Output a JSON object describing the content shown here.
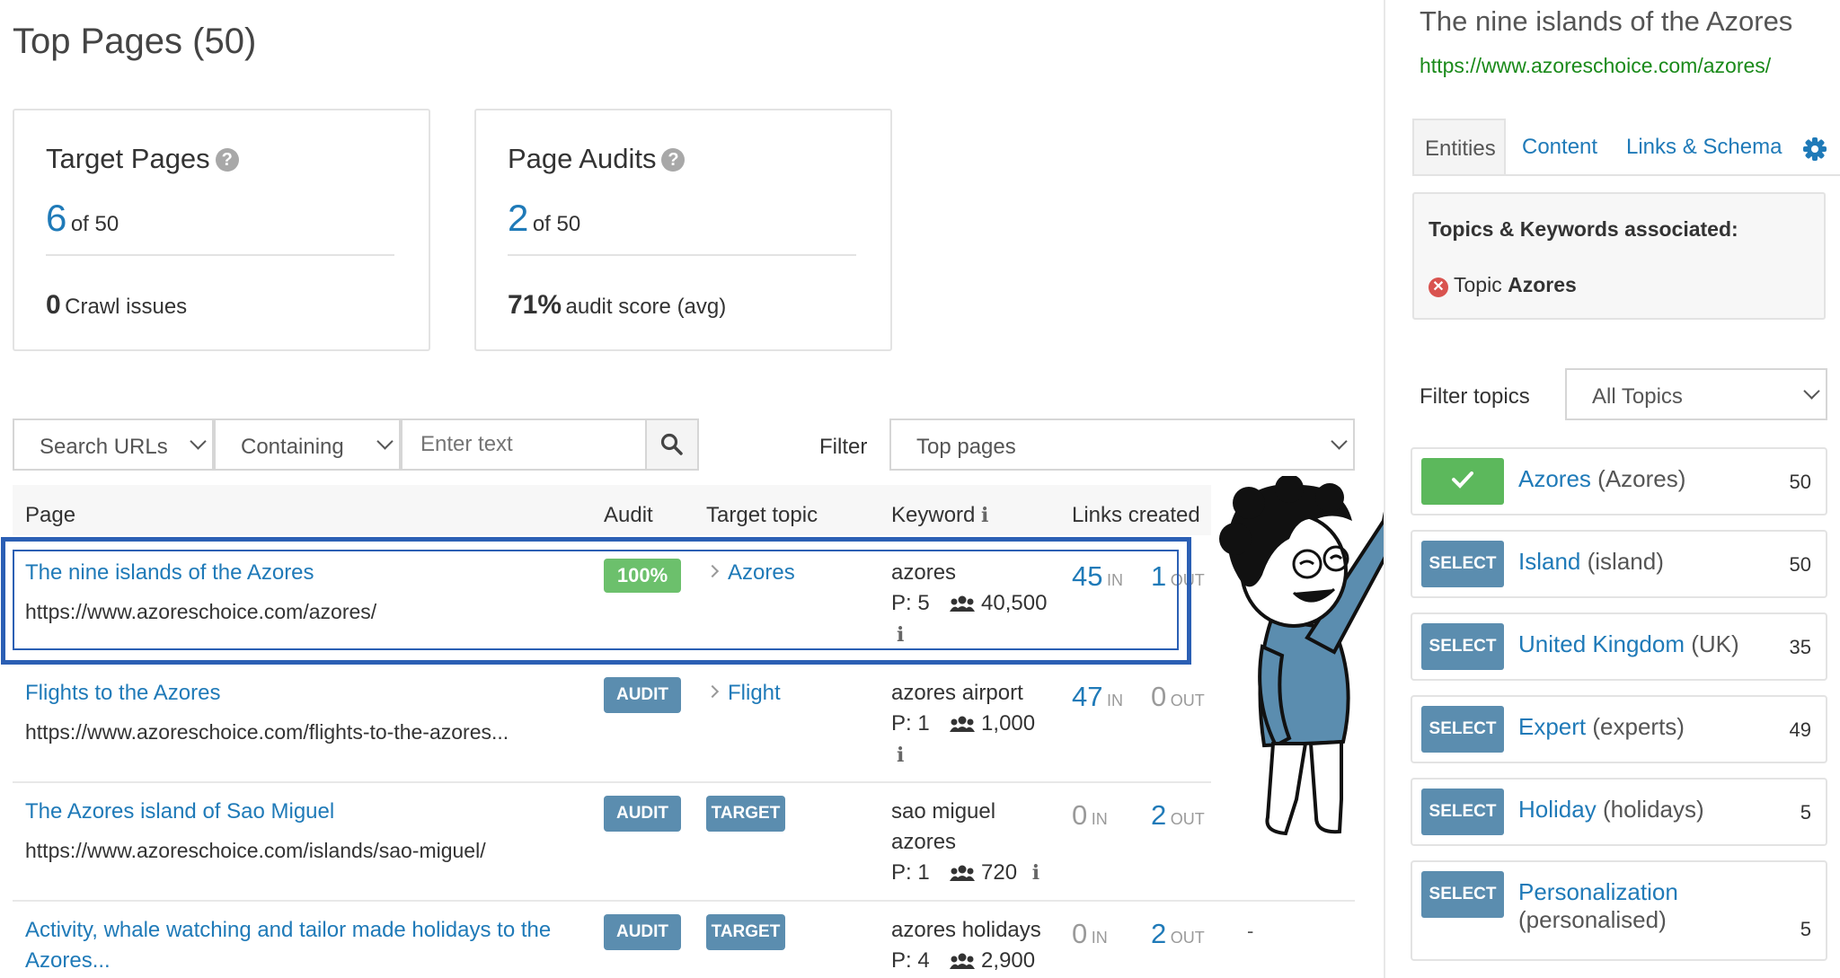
{
  "page": {
    "title": "Top Pages (50)"
  },
  "cards": {
    "target_pages": {
      "title": "Target Pages",
      "count": "6",
      "of": "of 50",
      "issues_count": "0",
      "issues_label": "Crawl issues"
    },
    "page_audits": {
      "title": "Page Audits",
      "count": "2",
      "of": "of 50",
      "score": "71%",
      "score_label": "audit score (avg)"
    }
  },
  "filters": {
    "search_select": "Search URLs",
    "mode_select": "Containing",
    "text_placeholder": "Enter text",
    "filter_label": "Filter",
    "filter_select": "Top pages"
  },
  "table": {
    "headers": {
      "page": "Page",
      "audit": "Audit",
      "topic": "Target topic",
      "keyword": "Keyword",
      "links": "Links created"
    },
    "in_label": "IN",
    "out_label": "OUT",
    "rows": [
      {
        "title": "The nine islands of the Azores",
        "url": "https://www.azoreschoice.com/azores/",
        "audit": "100%",
        "topic": "Azores",
        "keyword": "azores",
        "position": "P: 5",
        "volume": "40,500",
        "in": "45",
        "out": "1"
      },
      {
        "title": "Flights to the Azores",
        "url": "https://www.azoreschoice.com/flights-to-the-azores...",
        "audit": "AUDIT",
        "topic": "Flight",
        "keyword": "azores airport",
        "position": "P: 1",
        "volume": "1,000",
        "in": "47",
        "out": "0"
      },
      {
        "title": "The Azores island of Sao Miguel",
        "url": "https://www.azoreschoice.com/islands/sao-miguel/",
        "audit": "AUDIT",
        "topic": "TARGET",
        "keyword_line1": "sao miguel",
        "keyword_line2": "azores",
        "position": "P: 1",
        "volume": "720",
        "in": "0",
        "out": "2"
      },
      {
        "title_line1": "Activity, whale watching and tailor made holidays to the",
        "title_line2": "Azores...",
        "audit": "AUDIT",
        "topic": "TARGET",
        "keyword": "azores holidays",
        "position": "P: 4",
        "volume": "2,900",
        "in": "0",
        "out": "2",
        "extra": "-"
      }
    ]
  },
  "sidebar": {
    "title": "The nine islands of the Azores",
    "url": "https://www.azoreschoice.com/azores/",
    "tabs": [
      "Entities",
      "Content",
      "Links & Schema"
    ],
    "assoc_title": "Topics & Keywords associated:",
    "assoc_prefix": "Topic",
    "assoc_topic": "Azores",
    "filter_label": "Filter topics",
    "filter_select": "All Topics",
    "select_label": "SELECT",
    "topics": [
      {
        "name": "Azores",
        "paren": "(Azores)",
        "count": "50"
      },
      {
        "name": "Island",
        "paren": "(island)",
        "count": "50"
      },
      {
        "name": "United Kingdom",
        "paren": "(UK)",
        "count": "35"
      },
      {
        "name": "Expert",
        "paren": "(experts)",
        "count": "49"
      },
      {
        "name": "Holiday",
        "paren": "(holidays)",
        "count": "5"
      },
      {
        "name": "Personalization",
        "paren": "(personalised)",
        "count": "5"
      }
    ]
  },
  "colors": {
    "accent": "#1f7ab8",
    "button": "#5b8daf",
    "success": "#5cb85c",
    "highlight": "#2b5fb4",
    "url_green": "#1a8a1a"
  }
}
